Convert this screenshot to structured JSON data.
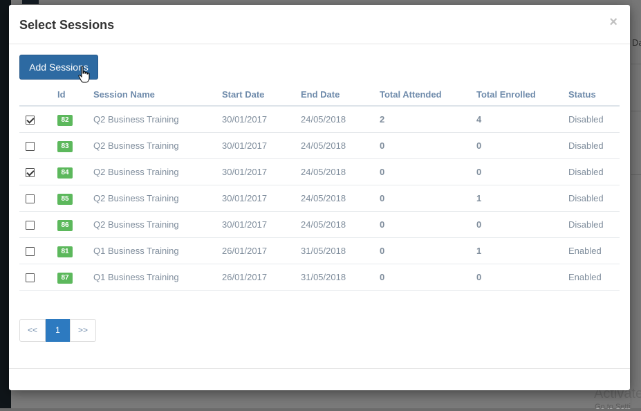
{
  "background": {
    "side_text": "Da",
    "watermark": "Activate",
    "watermark_sub": "Go to Setti"
  },
  "modal": {
    "title": "Select Sessions",
    "close_label": "×",
    "add_button_label": "Add Sessions"
  },
  "table": {
    "headers": [
      "",
      "Id",
      "Session Name",
      "Start Date",
      "End Date",
      "Total Attended",
      "Total Enrolled",
      "Status"
    ],
    "rows": [
      {
        "checked": true,
        "id": "82",
        "name": "Q2 Business Training",
        "start": "30/01/2017",
        "end": "24/05/2018",
        "attended": "2",
        "enrolled": "4",
        "status": "Disabled"
      },
      {
        "checked": false,
        "id": "83",
        "name": "Q2 Business Training",
        "start": "30/01/2017",
        "end": "24/05/2018",
        "attended": "0",
        "enrolled": "0",
        "status": "Disabled"
      },
      {
        "checked": true,
        "id": "84",
        "name": "Q2 Business Training",
        "start": "30/01/2017",
        "end": "24/05/2018",
        "attended": "0",
        "enrolled": "0",
        "status": "Disabled"
      },
      {
        "checked": false,
        "id": "85",
        "name": "Q2 Business Training",
        "start": "30/01/2017",
        "end": "24/05/2018",
        "attended": "0",
        "enrolled": "1",
        "status": "Disabled"
      },
      {
        "checked": false,
        "id": "86",
        "name": "Q2 Business Training",
        "start": "30/01/2017",
        "end": "24/05/2018",
        "attended": "0",
        "enrolled": "0",
        "status": "Disabled"
      },
      {
        "checked": false,
        "id": "81",
        "name": "Q1 Business Training",
        "start": "26/01/2017",
        "end": "31/05/2018",
        "attended": "0",
        "enrolled": "1",
        "status": "Enabled"
      },
      {
        "checked": false,
        "id": "87",
        "name": "Q1 Business Training",
        "start": "26/01/2017",
        "end": "31/05/2018",
        "attended": "0",
        "enrolled": "0",
        "status": "Enabled"
      }
    ]
  },
  "pagination": {
    "prev_label": "<<",
    "current_page": "1",
    "next_label": ">>"
  },
  "colors": {
    "primary": "#2d6aa2",
    "badge_green": "#5cb85c",
    "header_text": "#6f8bab"
  }
}
